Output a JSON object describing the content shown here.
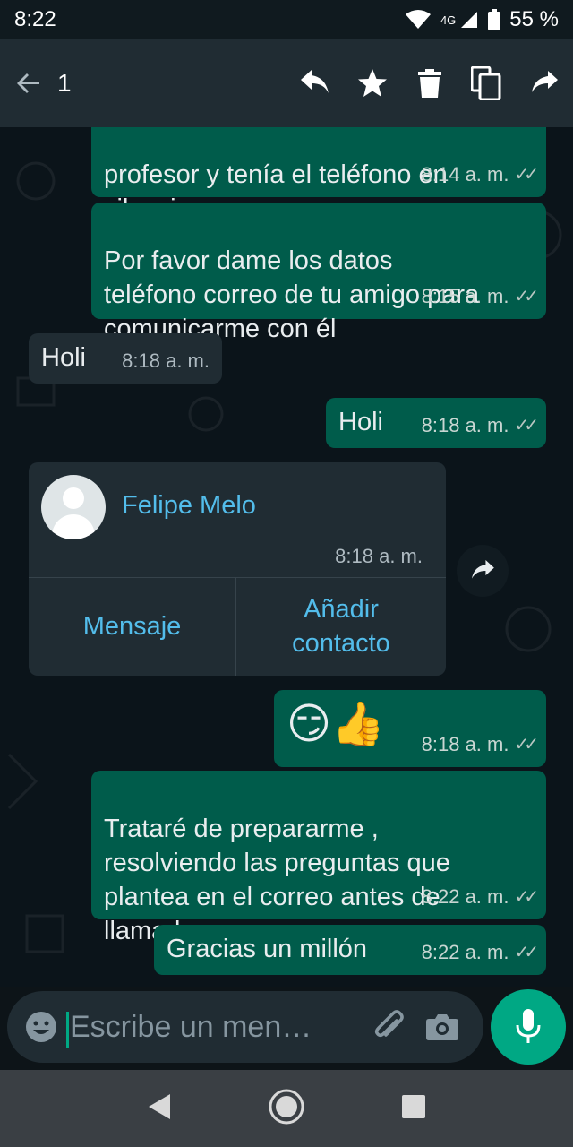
{
  "status_bar": {
    "time": "8:22",
    "network": "4G",
    "battery": "55 %"
  },
  "toolbar": {
    "selected_count": "1",
    "icons": [
      "back-arrow-icon",
      "reply-icon",
      "star-icon",
      "delete-icon",
      "copy-icon",
      "forward-icon"
    ]
  },
  "messages": [
    {
      "direction": "out",
      "text": "profesor y tenía el teléfono en\nsilencio",
      "time": "8:14 a. m.",
      "ticks": "✓✓"
    },
    {
      "direction": "out",
      "text": "Por favor dame los datos\nteléfono correo de tu amigo para\ncomunicarme con él",
      "time": "8:15 a. m.",
      "ticks": "✓✓"
    },
    {
      "direction": "in",
      "text": "Holi",
      "time": "8:18 a. m."
    },
    {
      "direction": "out",
      "text": "Holi",
      "time": "8:18 a. m.",
      "ticks": "✓✓"
    },
    {
      "direction": "out",
      "text": "😏👍",
      "time": "8:18 a. m.",
      "ticks": "✓✓"
    },
    {
      "direction": "out",
      "text": "Trataré de prepararme ,\nresolviendo las preguntas que\nplantea en el correo antes de\nllamarlo",
      "time": "8:22 a. m.",
      "ticks": "✓✓"
    },
    {
      "direction": "out",
      "text": "Gracias un millón",
      "time": "8:22 a. m.",
      "ticks": "✓✓"
    }
  ],
  "contact_card": {
    "name": "Felipe Melo",
    "time": "8:18 a. m.",
    "action_message": "Mensaje",
    "action_add": "Añadir\ncontacto"
  },
  "composer": {
    "placeholder": "Escribe un men…"
  },
  "colors": {
    "outgoing": "#005c4b",
    "incoming": "#202c33",
    "accent": "#00a884",
    "link": "#53bdeb"
  }
}
